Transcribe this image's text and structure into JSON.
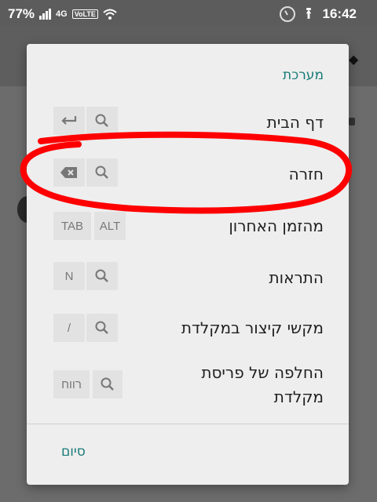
{
  "status_bar": {
    "battery": "77%",
    "network": "4G",
    "volte": "VoLTE",
    "time": "16:42"
  },
  "dialog": {
    "title": "מערכת",
    "rows": [
      {
        "label": "דף הבית",
        "keys": [
          "search-icon",
          "enter-icon"
        ]
      },
      {
        "label": "חזרה",
        "keys": [
          "search-icon",
          "backspace-icon"
        ]
      },
      {
        "label": "מהזמן האחרון",
        "keys": [
          "ALT",
          "TAB"
        ]
      },
      {
        "label": "התראות",
        "keys": [
          "search-icon",
          "N"
        ]
      },
      {
        "label": "מקשי קיצור במקלדת",
        "keys": [
          "search-icon",
          "/"
        ]
      },
      {
        "label_line1": "החלפה של פריסת",
        "label_line2": "מקלדת",
        "keys": [
          "search-icon",
          "רווח"
        ]
      }
    ],
    "done_label": "סיום"
  },
  "annotation": {
    "color": "#ff0000",
    "shape": "hand-drawn-ellipse"
  }
}
